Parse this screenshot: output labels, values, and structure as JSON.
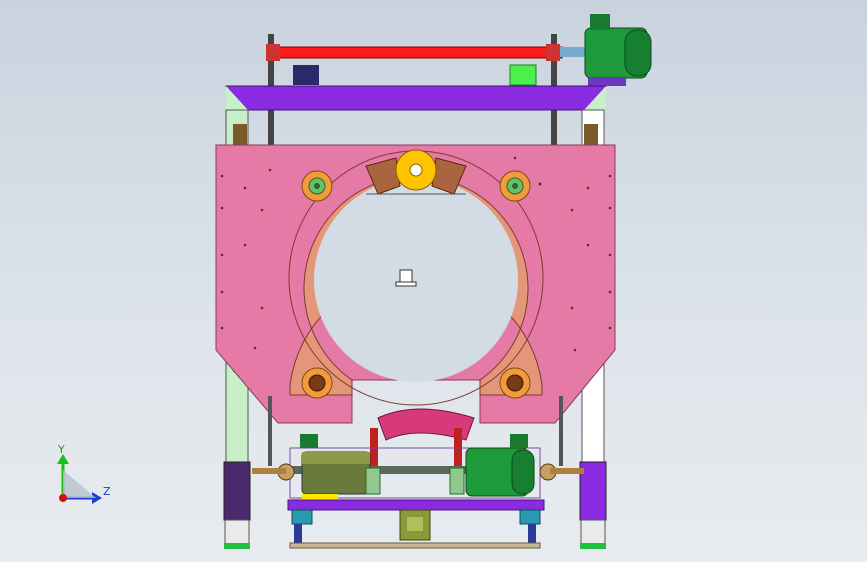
{
  "triad": {
    "y_label": "Y",
    "z_label": "Z",
    "colors": {
      "y": "#18c018",
      "z": "#1a3fd0",
      "origin": "#d01010"
    }
  },
  "palette": {
    "pink_plate": "#e57aa7",
    "ring": "#e5967a",
    "ring_segment": "#a8653f",
    "purple": "#8a2be2",
    "red_bar": "#ff1a1a",
    "green_motor": "#1f9a3a",
    "yellow_wheel": "#ffc300",
    "roller_orange": "#f39a3a",
    "light_green": "#c8f0c8",
    "navy": "#2a2a6a"
  }
}
